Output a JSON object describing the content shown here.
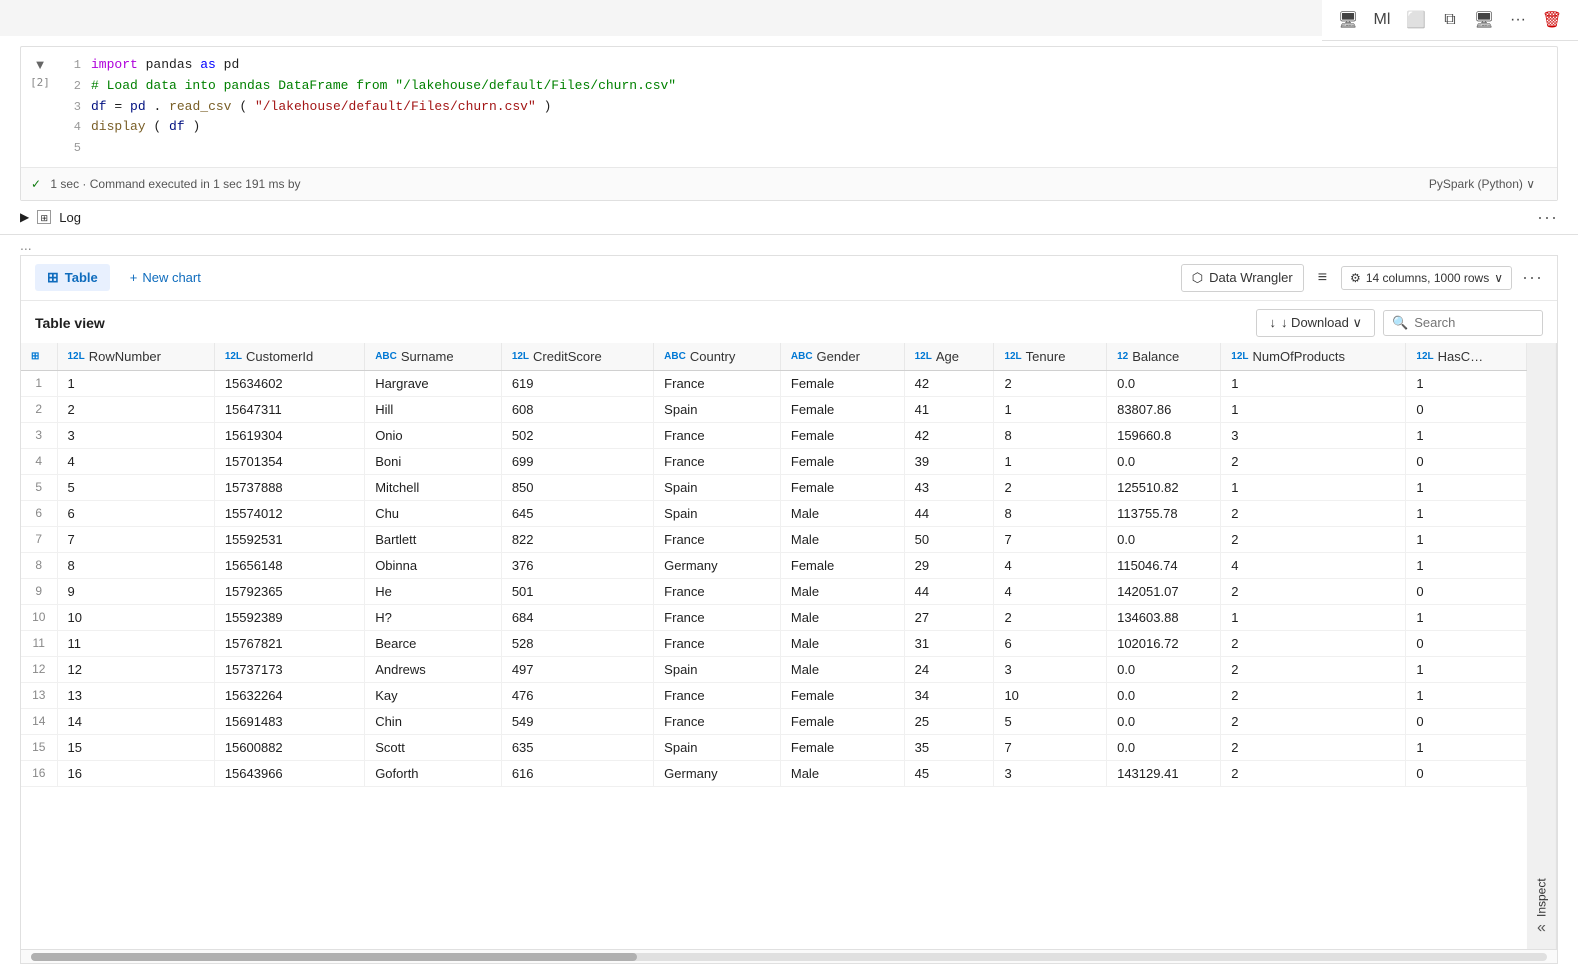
{
  "topToolbar": {
    "buttons": [
      "copy-icon",
      "ml-icon",
      "window-icon",
      "duplicate-icon",
      "present-icon",
      "more-icon",
      "delete-icon"
    ]
  },
  "codeCell": {
    "cellIndex": "[2]",
    "lines": [
      {
        "num": 1,
        "tokens": [
          {
            "t": "import",
            "c": "kw-import"
          },
          {
            "t": " pandas ",
            "c": ""
          },
          {
            "t": "as",
            "c": "kw-blue"
          },
          {
            "t": " pd",
            "c": ""
          }
        ]
      },
      {
        "num": 2,
        "tokens": [
          {
            "t": "# Load data into pandas DataFrame from \"/lakehouse/default/Files/churn.csv\"",
            "c": "comment-color"
          }
        ]
      },
      {
        "num": 3,
        "tokens": [
          {
            "t": "df",
            "c": "var-color"
          },
          {
            "t": " = ",
            "c": ""
          },
          {
            "t": "pd",
            "c": "var-color"
          },
          {
            "t": ".",
            "c": ""
          },
          {
            "t": "read_csv",
            "c": "fn-color"
          },
          {
            "t": "(",
            "c": ""
          },
          {
            "t": "\"/lakehouse/default/Files/churn.csv\"",
            "c": "str-color"
          },
          {
            "t": ")",
            "c": ""
          }
        ]
      },
      {
        "num": 4,
        "tokens": [
          {
            "t": "display",
            "c": "fn-color"
          },
          {
            "t": "(",
            "c": ""
          },
          {
            "t": "df",
            "c": "var-color"
          },
          {
            "t": ")",
            "c": ""
          }
        ]
      },
      {
        "num": 5,
        "tokens": []
      }
    ],
    "status": "✓  1 sec · Command executed in 1 sec 191 ms by",
    "runtime": "PySpark (Python) ∨"
  },
  "logBar": {
    "label": "Log"
  },
  "ellipsis": "...",
  "outputPanel": {
    "tableTab": "Table",
    "newChart": "+ New chart",
    "dataWrangler": "Data Wrangler",
    "filterIcon": "≡",
    "colSettings": "⚙ 14 columns, 1000 rows ∨",
    "tableView": "Table view",
    "download": "↓  Download ∨",
    "searchPlaceholder": "Search",
    "inspectTab": "Inspect",
    "collapseIcon": "»",
    "columns": [
      {
        "icon": "⊞",
        "name": "",
        "type": ""
      },
      {
        "icon": "12L",
        "name": "RowNumber",
        "type": "12L"
      },
      {
        "icon": "12L",
        "name": "CustomerId",
        "type": "12L"
      },
      {
        "icon": "ABC",
        "name": "Surname",
        "type": "ABC"
      },
      {
        "icon": "12L",
        "name": "CreditScore",
        "type": "12L"
      },
      {
        "icon": "ABC",
        "name": "Country",
        "type": "ABC"
      },
      {
        "icon": "ABC",
        "name": "Gender",
        "type": "ABC"
      },
      {
        "icon": "12L",
        "name": "Age",
        "type": "12L"
      },
      {
        "icon": "12L",
        "name": "Tenure",
        "type": "12L"
      },
      {
        "icon": "12",
        "name": "Balance",
        "type": "12"
      },
      {
        "icon": "12L",
        "name": "NumOfProducts",
        "type": "12L"
      },
      {
        "icon": "12L",
        "name": "HasC…",
        "type": "12L"
      }
    ],
    "rows": [
      [
        1,
        1,
        15634602,
        "Hargrave",
        619,
        "France",
        "Female",
        42,
        2,
        "0.0",
        1,
        1
      ],
      [
        2,
        2,
        15647311,
        "Hill",
        608,
        "Spain",
        "Female",
        41,
        1,
        "83807.86",
        1,
        0
      ],
      [
        3,
        3,
        15619304,
        "Onio",
        502,
        "France",
        "Female",
        42,
        8,
        "159660.8",
        3,
        1
      ],
      [
        4,
        4,
        15701354,
        "Boni",
        699,
        "France",
        "Female",
        39,
        1,
        "0.0",
        2,
        0
      ],
      [
        5,
        5,
        15737888,
        "Mitchell",
        850,
        "Spain",
        "Female",
        43,
        2,
        "125510.82",
        1,
        1
      ],
      [
        6,
        6,
        15574012,
        "Chu",
        645,
        "Spain",
        "Male",
        44,
        8,
        "113755.78",
        2,
        1
      ],
      [
        7,
        7,
        15592531,
        "Bartlett",
        822,
        "France",
        "Male",
        50,
        7,
        "0.0",
        2,
        1
      ],
      [
        8,
        8,
        15656148,
        "Obinna",
        376,
        "Germany",
        "Female",
        29,
        4,
        "115046.74",
        4,
        1
      ],
      [
        9,
        9,
        15792365,
        "He",
        501,
        "France",
        "Male",
        44,
        4,
        "142051.07",
        2,
        0
      ],
      [
        10,
        10,
        15592389,
        "H?",
        684,
        "France",
        "Male",
        27,
        2,
        "134603.88",
        1,
        1
      ],
      [
        11,
        11,
        15767821,
        "Bearce",
        528,
        "France",
        "Male",
        31,
        6,
        "102016.72",
        2,
        0
      ],
      [
        12,
        12,
        15737173,
        "Andrews",
        497,
        "Spain",
        "Male",
        24,
        3,
        "0.0",
        2,
        1
      ],
      [
        13,
        13,
        15632264,
        "Kay",
        476,
        "France",
        "Female",
        34,
        10,
        "0.0",
        2,
        1
      ],
      [
        14,
        14,
        15691483,
        "Chin",
        549,
        "France",
        "Female",
        25,
        5,
        "0.0",
        2,
        0
      ],
      [
        15,
        15,
        15600882,
        "Scott",
        635,
        "Spain",
        "Female",
        35,
        7,
        "0.0",
        2,
        1
      ],
      [
        16,
        16,
        15643966,
        "Goforth",
        616,
        "Germany",
        "Male",
        45,
        3,
        "143129.41",
        2,
        0
      ]
    ]
  }
}
